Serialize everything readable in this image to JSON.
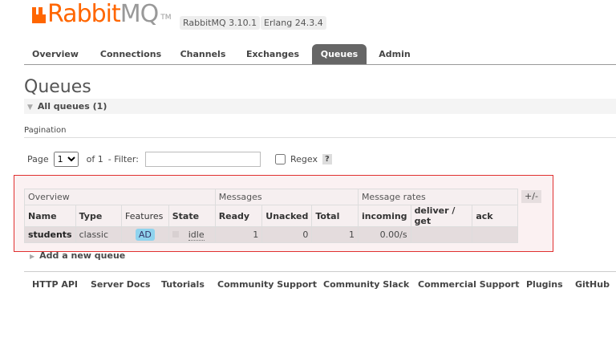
{
  "brand": {
    "logo_text_a": "Rabbit",
    "logo_text_b": "MQ",
    "tm": "TM",
    "colors": {
      "orange": "#ff6600",
      "gray": "#999999"
    }
  },
  "versions": {
    "rabbitmq": "RabbitMQ 3.10.1",
    "erlang": "Erlang 24.3.4"
  },
  "nav": {
    "tabs": [
      {
        "label": "Overview"
      },
      {
        "label": "Connections"
      },
      {
        "label": "Channels"
      },
      {
        "label": "Exchanges"
      },
      {
        "label": "Queues",
        "active": true
      },
      {
        "label": "Admin"
      }
    ]
  },
  "page": {
    "title": "Queues",
    "section": "All queues (1)",
    "pagination_label": "Pagination"
  },
  "pager": {
    "page_label": "Page",
    "page_value": "1",
    "of_label": "of 1",
    "filter_label": "- Filter:",
    "filter_value": "",
    "regex_label": "Regex",
    "regex_checked": false,
    "help": "?"
  },
  "table": {
    "groups": [
      "Overview",
      "Messages",
      "Message rates"
    ],
    "columns": [
      "Name",
      "Type",
      "Features",
      "State",
      "Ready",
      "Unacked",
      "Total",
      "incoming",
      "deliver / get",
      "ack"
    ],
    "rows": [
      {
        "name": "students",
        "type": "classic",
        "features": "AD",
        "state": "idle",
        "ready": "1",
        "unacked": "0",
        "total": "1",
        "incoming": "0.00/s",
        "deliver_get": "",
        "ack": ""
      }
    ],
    "toggle": "+/-"
  },
  "add_queue": "Add a new queue",
  "footer": {
    "links": [
      "HTTP API",
      "Server Docs",
      "Tutorials",
      "Community Support",
      "Community Slack",
      "Commercial Support",
      "Plugins",
      "GitHub"
    ]
  }
}
